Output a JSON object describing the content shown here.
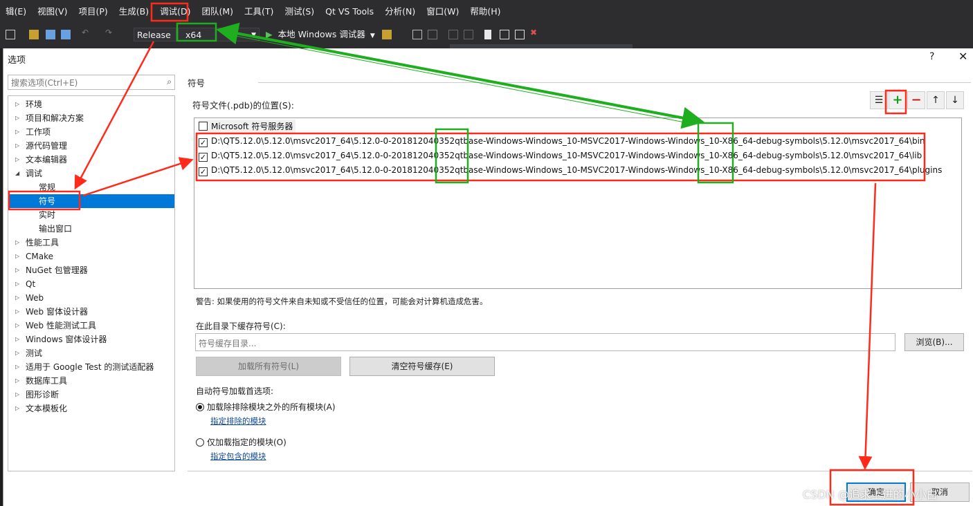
{
  "menu": [
    "辑(E)",
    "视图(V)",
    "项目(P)",
    "生成(B)",
    "调试(D)",
    "团队(M)",
    "工具(T)",
    "测试(S)",
    "Qt VS Tools",
    "分析(N)",
    "窗口(W)",
    "帮助(H)"
  ],
  "toolbar": {
    "config": "Release",
    "platform": "x64",
    "run_label": "本地 Windows 调试器"
  },
  "dialog": {
    "title": "选项",
    "help": "?",
    "close": "✕"
  },
  "search": {
    "placeholder": "搜索选项(Ctrl+E)"
  },
  "tree": [
    {
      "label": "环境",
      "arrow": "▷"
    },
    {
      "label": "项目和解决方案",
      "arrow": "▷"
    },
    {
      "label": "工作项",
      "arrow": "▷"
    },
    {
      "label": "源代码管理",
      "arrow": "▷"
    },
    {
      "label": "文本编辑器",
      "arrow": "▷"
    },
    {
      "label": "调试",
      "arrow": "◢"
    },
    {
      "label": "常规",
      "arrow": ""
    },
    {
      "label": "符号",
      "arrow": ""
    },
    {
      "label": "实时",
      "arrow": ""
    },
    {
      "label": "输出窗口",
      "arrow": ""
    },
    {
      "label": "性能工具",
      "arrow": "▷"
    },
    {
      "label": "CMake",
      "arrow": "▷"
    },
    {
      "label": "NuGet 包管理器",
      "arrow": "▷"
    },
    {
      "label": "Qt",
      "arrow": "▷"
    },
    {
      "label": "Web",
      "arrow": "▷"
    },
    {
      "label": "Web 窗体设计器",
      "arrow": "▷"
    },
    {
      "label": "Web 性能测试工具",
      "arrow": "▷"
    },
    {
      "label": "Windows 窗体设计器",
      "arrow": "▷"
    },
    {
      "label": "测试",
      "arrow": "▷"
    },
    {
      "label": "适用于 Google Test 的测试适配器",
      "arrow": "▷"
    },
    {
      "label": "数据库工具",
      "arrow": "▷"
    },
    {
      "label": "图形诊断",
      "arrow": "▷"
    },
    {
      "label": "文本模板化",
      "arrow": "▷"
    }
  ],
  "symbols": {
    "pane_title": "符号",
    "locations_label": "符号文件(.pdb)的位置(S):",
    "server": {
      "label": "Microsoft 符号服务器",
      "checked": false
    },
    "paths": [
      {
        "path": "D:\\QT5.12.0\\5.12.0\\msvc2017_64\\5.12.0-0-201812040352qtbase-Windows-Windows_10-MSVC2017-Windows-Windows_10-X86_64-debug-symbols\\5.12.0\\msvc2017_64\\bin",
        "checked": true
      },
      {
        "path": "D:\\QT5.12.0\\5.12.0\\msvc2017_64\\5.12.0-0-201812040352qtbase-Windows-Windows_10-MSVC2017-Windows-Windows_10-X86_64-debug-symbols\\5.12.0\\msvc2017_64\\lib",
        "checked": true
      },
      {
        "path": "D:\\QT5.12.0\\5.12.0\\msvc2017_64\\5.12.0-0-201812040352qtbase-Windows-Windows_10-MSVC2017-Windows-Windows_10-X86_64-debug-symbols\\5.12.0\\msvc2017_64\\plugins",
        "checked": true
      }
    ],
    "warning": "警告: 如果使用的符号文件来自未知或不受信任的位置，可能会对计算机造成危害。",
    "cache_label": "在此目录下缓存符号(C):",
    "cache_placeholder": "符号缓存目录...",
    "browse": "浏览(B)...",
    "load_all": "加载所有符号(L)",
    "clear_cache": "清空符号缓存(E)",
    "auto_label": "自动符号加载首选项:",
    "option1": "加载除排除模块之外的所有模块(A)",
    "option1_link": "指定排除的模块",
    "option2": "仅加载指定的模块(O)",
    "option2_link": "指定包含的模块",
    "selected_option": 1
  },
  "buttons": {
    "ok": "确定",
    "cancel": "取消"
  },
  "watermark": "CSDN @追求上进的小小白",
  "colors": {
    "red_annotation": "#ff2a1a",
    "green_annotation": "#1fae1f",
    "selection": "#0078d7",
    "vs_dark": "#2d2d30"
  }
}
